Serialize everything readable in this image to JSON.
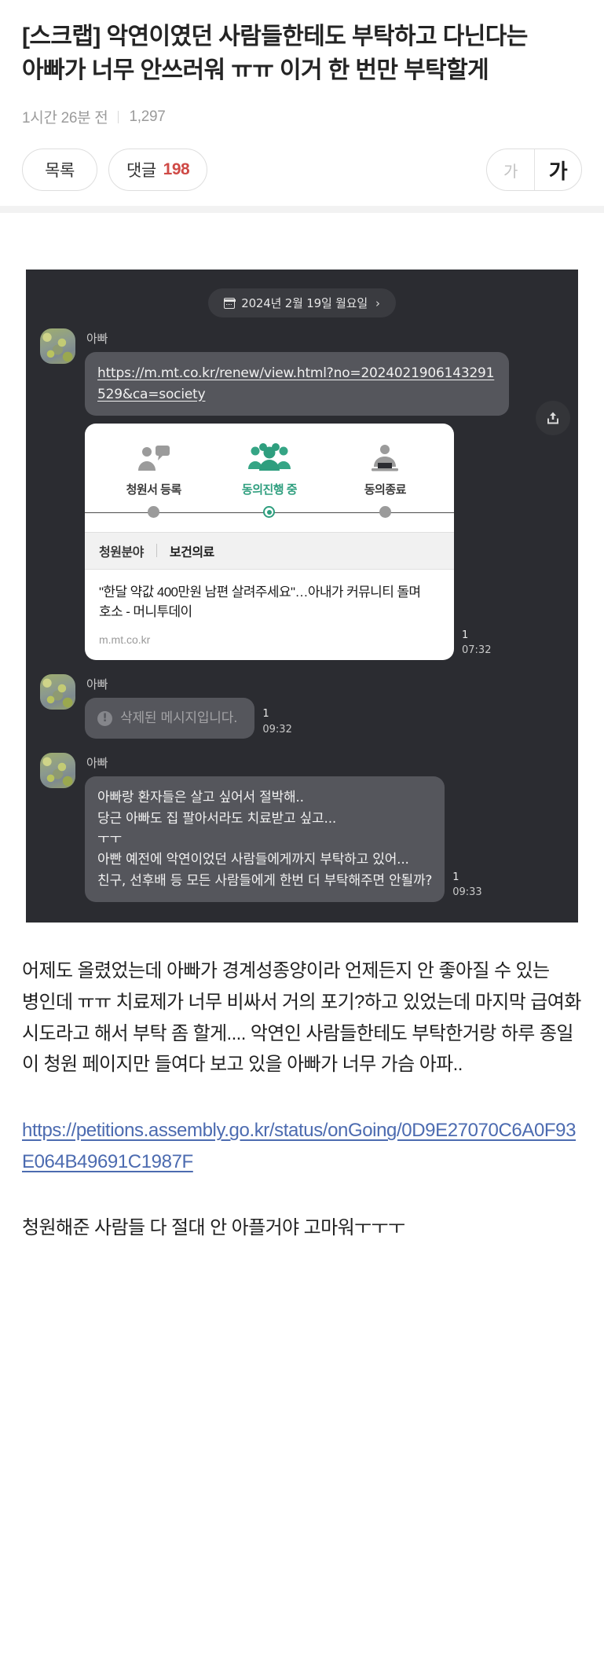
{
  "post": {
    "title": "[스크랩] 악연이였던 사람들한테도 부탁하고 다닌다는 아빠가 너무 안쓰러워 ㅠㅠ 이거 한 번만 부탁할게",
    "time_ago": "1시간 26분 전",
    "view_count": "1,297"
  },
  "actions": {
    "list_label": "목록",
    "comment_label": "댓글",
    "comment_count": "198",
    "font_small": "가",
    "font_large": "가"
  },
  "chat": {
    "date_divider": "2024년 2월 19일 월요일",
    "date_chevron": "›",
    "messages": [
      {
        "sender": "아빠",
        "link_text": "https://m.mt.co.kr/renew/view.html?no=2024021906143291529&ca=society",
        "unread": "1",
        "time": "07:32"
      },
      {
        "sender": "아빠",
        "deleted_text": "삭제된 메시지입니다.",
        "unread": "1",
        "time": "09:32"
      },
      {
        "sender": "아빠",
        "text": "아빠랑 환자들은 살고 싶어서 절박해..\n당근 아빠도 집 팔아서라도 치료받고 싶고...\nㅜㅜ\n아빤 예전에 악연이었던 사람들에게까지 부탁하고 있어...\n친구, 선후배 등 모든 사람들에게 한번 더 부탁해주면 안될까?",
        "unread": "1",
        "time": "09:33"
      }
    ],
    "preview": {
      "steps": [
        {
          "label": "청원서 등록",
          "state": "done"
        },
        {
          "label": "동의진행 중",
          "state": "active"
        },
        {
          "label": "동의종료",
          "state": "pending"
        }
      ],
      "field_key": "청원분야",
      "field_value": "보건의료",
      "title": "\"한달 약값 400만원 남편 살려주세요\"…아내가 커뮤니티 돌며 호소 - 머니투데이",
      "domain": "m.mt.co.kr"
    }
  },
  "article": {
    "paragraph_1": "어제도 올렸었는데 아빠가 경계성종양이라 언제든지 안 좋아질 수 있는 병인데 ㅠㅠ 치료제가 너무 비싸서 거의 포기?하고 있었는데 마지막 급여화 시도라고 해서 부탁 좀 할게.... 악연인 사람들한테도 부탁한거랑 하루 종일 이 청원 페이지만 들여다 보고 있을 아빠가 너무 가슴 아파..",
    "link": "https://petitions.assembly.go.kr/status/onGoing/0D9E27070C6A0F93E064B49691C1987F",
    "paragraph_2": "청원해준 사람들 다 절대 안 아플거야 고마워ㅜㅜㅜ"
  },
  "colors": {
    "accent_green": "#2e9e7e",
    "comment_red": "#cf4a46",
    "link_blue": "#4c6bb0",
    "chat_bg": "#2b2c31",
    "bubble_bg": "#55565c"
  }
}
